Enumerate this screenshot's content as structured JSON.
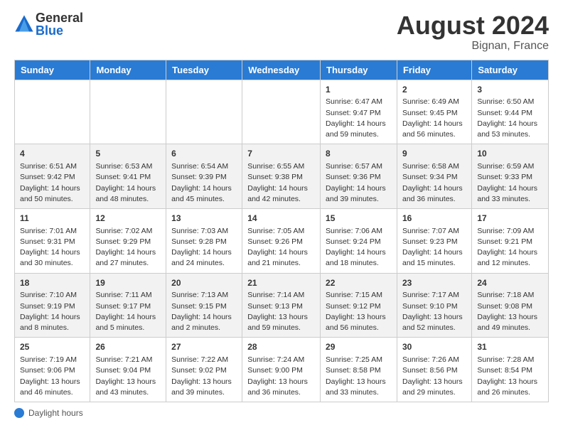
{
  "header": {
    "logo_general": "General",
    "logo_blue": "Blue",
    "month_title": "August 2024",
    "location": "Bignan, France"
  },
  "footer": {
    "label": "Daylight hours"
  },
  "days_of_week": [
    "Sunday",
    "Monday",
    "Tuesday",
    "Wednesday",
    "Thursday",
    "Friday",
    "Saturday"
  ],
  "weeks": [
    [
      {
        "day": "",
        "info": ""
      },
      {
        "day": "",
        "info": ""
      },
      {
        "day": "",
        "info": ""
      },
      {
        "day": "",
        "info": ""
      },
      {
        "day": "1",
        "info": "Sunrise: 6:47 AM\nSunset: 9:47 PM\nDaylight: 14 hours\nand 59 minutes."
      },
      {
        "day": "2",
        "info": "Sunrise: 6:49 AM\nSunset: 9:45 PM\nDaylight: 14 hours\nand 56 minutes."
      },
      {
        "day": "3",
        "info": "Sunrise: 6:50 AM\nSunset: 9:44 PM\nDaylight: 14 hours\nand 53 minutes."
      }
    ],
    [
      {
        "day": "4",
        "info": "Sunrise: 6:51 AM\nSunset: 9:42 PM\nDaylight: 14 hours\nand 50 minutes."
      },
      {
        "day": "5",
        "info": "Sunrise: 6:53 AM\nSunset: 9:41 PM\nDaylight: 14 hours\nand 48 minutes."
      },
      {
        "day": "6",
        "info": "Sunrise: 6:54 AM\nSunset: 9:39 PM\nDaylight: 14 hours\nand 45 minutes."
      },
      {
        "day": "7",
        "info": "Sunrise: 6:55 AM\nSunset: 9:38 PM\nDaylight: 14 hours\nand 42 minutes."
      },
      {
        "day": "8",
        "info": "Sunrise: 6:57 AM\nSunset: 9:36 PM\nDaylight: 14 hours\nand 39 minutes."
      },
      {
        "day": "9",
        "info": "Sunrise: 6:58 AM\nSunset: 9:34 PM\nDaylight: 14 hours\nand 36 minutes."
      },
      {
        "day": "10",
        "info": "Sunrise: 6:59 AM\nSunset: 9:33 PM\nDaylight: 14 hours\nand 33 minutes."
      }
    ],
    [
      {
        "day": "11",
        "info": "Sunrise: 7:01 AM\nSunset: 9:31 PM\nDaylight: 14 hours\nand 30 minutes."
      },
      {
        "day": "12",
        "info": "Sunrise: 7:02 AM\nSunset: 9:29 PM\nDaylight: 14 hours\nand 27 minutes."
      },
      {
        "day": "13",
        "info": "Sunrise: 7:03 AM\nSunset: 9:28 PM\nDaylight: 14 hours\nand 24 minutes."
      },
      {
        "day": "14",
        "info": "Sunrise: 7:05 AM\nSunset: 9:26 PM\nDaylight: 14 hours\nand 21 minutes."
      },
      {
        "day": "15",
        "info": "Sunrise: 7:06 AM\nSunset: 9:24 PM\nDaylight: 14 hours\nand 18 minutes."
      },
      {
        "day": "16",
        "info": "Sunrise: 7:07 AM\nSunset: 9:23 PM\nDaylight: 14 hours\nand 15 minutes."
      },
      {
        "day": "17",
        "info": "Sunrise: 7:09 AM\nSunset: 9:21 PM\nDaylight: 14 hours\nand 12 minutes."
      }
    ],
    [
      {
        "day": "18",
        "info": "Sunrise: 7:10 AM\nSunset: 9:19 PM\nDaylight: 14 hours\nand 8 minutes."
      },
      {
        "day": "19",
        "info": "Sunrise: 7:11 AM\nSunset: 9:17 PM\nDaylight: 14 hours\nand 5 minutes."
      },
      {
        "day": "20",
        "info": "Sunrise: 7:13 AM\nSunset: 9:15 PM\nDaylight: 14 hours\nand 2 minutes."
      },
      {
        "day": "21",
        "info": "Sunrise: 7:14 AM\nSunset: 9:13 PM\nDaylight: 13 hours\nand 59 minutes."
      },
      {
        "day": "22",
        "info": "Sunrise: 7:15 AM\nSunset: 9:12 PM\nDaylight: 13 hours\nand 56 minutes."
      },
      {
        "day": "23",
        "info": "Sunrise: 7:17 AM\nSunset: 9:10 PM\nDaylight: 13 hours\nand 52 minutes."
      },
      {
        "day": "24",
        "info": "Sunrise: 7:18 AM\nSunset: 9:08 PM\nDaylight: 13 hours\nand 49 minutes."
      }
    ],
    [
      {
        "day": "25",
        "info": "Sunrise: 7:19 AM\nSunset: 9:06 PM\nDaylight: 13 hours\nand 46 minutes."
      },
      {
        "day": "26",
        "info": "Sunrise: 7:21 AM\nSunset: 9:04 PM\nDaylight: 13 hours\nand 43 minutes."
      },
      {
        "day": "27",
        "info": "Sunrise: 7:22 AM\nSunset: 9:02 PM\nDaylight: 13 hours\nand 39 minutes."
      },
      {
        "day": "28",
        "info": "Sunrise: 7:24 AM\nSunset: 9:00 PM\nDaylight: 13 hours\nand 36 minutes."
      },
      {
        "day": "29",
        "info": "Sunrise: 7:25 AM\nSunset: 8:58 PM\nDaylight: 13 hours\nand 33 minutes."
      },
      {
        "day": "30",
        "info": "Sunrise: 7:26 AM\nSunset: 8:56 PM\nDaylight: 13 hours\nand 29 minutes."
      },
      {
        "day": "31",
        "info": "Sunrise: 7:28 AM\nSunset: 8:54 PM\nDaylight: 13 hours\nand 26 minutes."
      }
    ]
  ]
}
